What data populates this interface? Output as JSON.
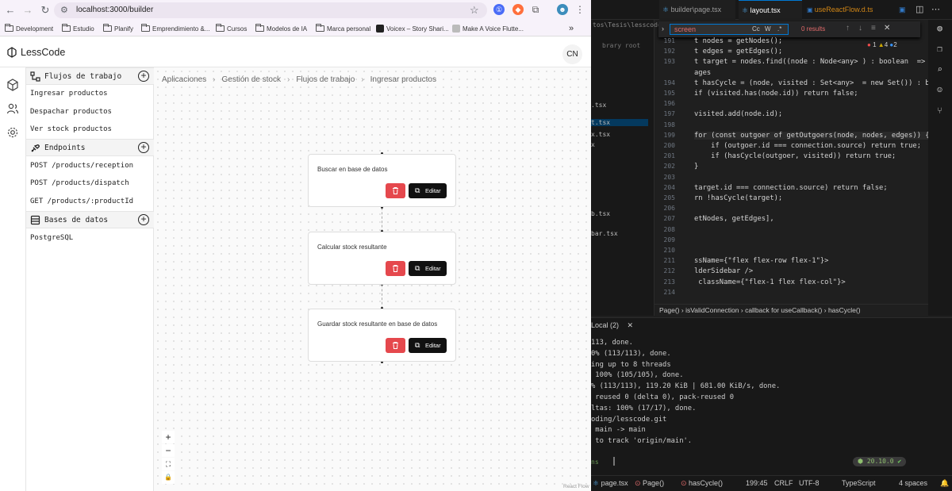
{
  "browser": {
    "url": "localhost:3000/builder",
    "bookmarks": [
      "Development",
      "Estudio",
      "Planify",
      "Emprendimiento &...",
      "Cursos",
      "Modelos de IA",
      "Marca personal",
      "Voicex – Story Shari...",
      "Make A Voice Flutte..."
    ]
  },
  "app": {
    "name": "LessCode",
    "avatar": "CN",
    "sidebar": {
      "sections": [
        {
          "title": "Flujos de trabajo",
          "items": [
            "Ingresar productos",
            "Despachar productos",
            "Ver stock productos"
          ]
        },
        {
          "title": "Endpoints",
          "items": [
            "POST /products/reception",
            "POST /products/dispatch",
            "GET /products/:productId"
          ]
        },
        {
          "title": "Bases de datos",
          "items": [
            "PostgreSQL"
          ]
        }
      ]
    },
    "breadcrumb": [
      "Aplicaciones",
      "Gestión de stock",
      "Flujos de trabajo",
      "Ingresar productos"
    ],
    "nodes": [
      {
        "text": "Buscar en base de datos",
        "edit_label": "Editar"
      },
      {
        "text": "Calcular stock resultante",
        "edit_label": "Editar"
      },
      {
        "text": "Guardar stock resultante en base de datos",
        "edit_label": "Editar"
      }
    ],
    "canvas_controls": [
      "+",
      "−",
      "⛶",
      "🔒"
    ],
    "attribution": "React Flow"
  },
  "editor": {
    "tabs": [
      "builder\\page.tsx",
      "layout.tsx",
      "useReactFlow.d.ts"
    ],
    "find": {
      "query": "screen",
      "options": [
        "Cc",
        "W",
        ".*"
      ],
      "results": "0 results"
    },
    "explorer_header": "tos\\Tesis\\lesscode",
    "explorer_lines": [
      "brary root",
      "",
      "",
      ".tsx",
      "",
      "t.tsx",
      "x.tsx",
      "x",
      "",
      "",
      "",
      "",
      "",
      "",
      "",
      "",
      "",
      "b.tsx",
      "",
      "bar.tsx"
    ],
    "problems": {
      "errors": "1",
      "warnings": "4",
      "info": "2"
    },
    "line_numbers": [
      "191",
      "192",
      "193",
      "",
      "194",
      "195",
      "196",
      "197",
      "198",
      "199",
      "200",
      "201",
      "202",
      "203",
      "204",
      "205",
      "206",
      "207",
      "208",
      "209",
      "210",
      "211",
      "212",
      "213",
      "214"
    ],
    "code_lines": [
      "t nodes = getNodes();",
      "t edges = getEdges();",
      "t target = nodes.find((node : Node<any> ) : boolean  => node.id",
      "ages",
      "t hasCycle = (node, visited : Set<any>  = new Set()) : boolean",
      "if (visited.has(node.id)) return false;",
      "",
      "visited.add(node.id);",
      "",
      "for (const outgoer of getOutgoers(node, nodes, edges)) {",
      "    if (outgoer.id === connection.source) return true;",
      "    if (hasCycle(outgoer, visited)) return true;",
      "}",
      "",
      "target.id === connection.source) return false;",
      "rn !hasCycle(target);",
      "",
      "etNodes, getEdges],",
      "",
      "",
      "",
      "ssName={\"flex flex-row flex-1\"}>",
      "lderSidebar />",
      " className={\"flex-1 flex flex-col\"}>",
      ""
    ],
    "breadcrumbs": [
      "Page()",
      "isValidConnection",
      "callback for useCallback()",
      "hasCycle()"
    ],
    "terminal_tab": "Local (2)",
    "terminal_lines": [
      "113, done.",
      "0% (113/113), done.",
      "ing up to 8 threads",
      " 100% (105/105), done.",
      "% (113/113), 119.20 KiB | 681.00 KiB/s, done.",
      " reused 0 (delta 0), pack-reused 0",
      "ltas: 100% (17/17), done.",
      "oding/lesscode.git",
      " main -> main",
      " to track 'origin/main'."
    ],
    "terminal_prompt_node": "20.10.0",
    "status": {
      "file": "page.tsx",
      "crumb1": "Page()",
      "crumb2": "hasCycle()",
      "position": "199:45",
      "eol": "CRLF",
      "encoding": "UTF-8",
      "language": "TypeScript",
      "indent": "4 spaces"
    }
  },
  "colors": {
    "delete": "#e5484d",
    "edit": "#111111",
    "editor_bg": "#1f1f1f",
    "accent": "#e5484d"
  }
}
